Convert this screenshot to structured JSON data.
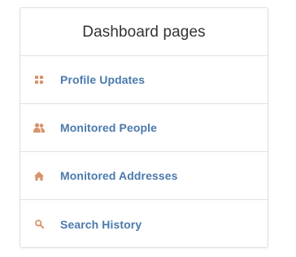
{
  "panel": {
    "title": "Dashboard pages"
  },
  "colors": {
    "icon": "#d8926c",
    "link": "#4a79ad",
    "title": "#333333",
    "border": "#e2e2e2"
  },
  "nav": {
    "items": [
      {
        "label": "Profile Updates",
        "icon": "grid-icon"
      },
      {
        "label": "Monitored People",
        "icon": "users-icon"
      },
      {
        "label": "Monitored Addresses",
        "icon": "home-icon"
      },
      {
        "label": "Search History",
        "icon": "search-icon"
      }
    ]
  }
}
